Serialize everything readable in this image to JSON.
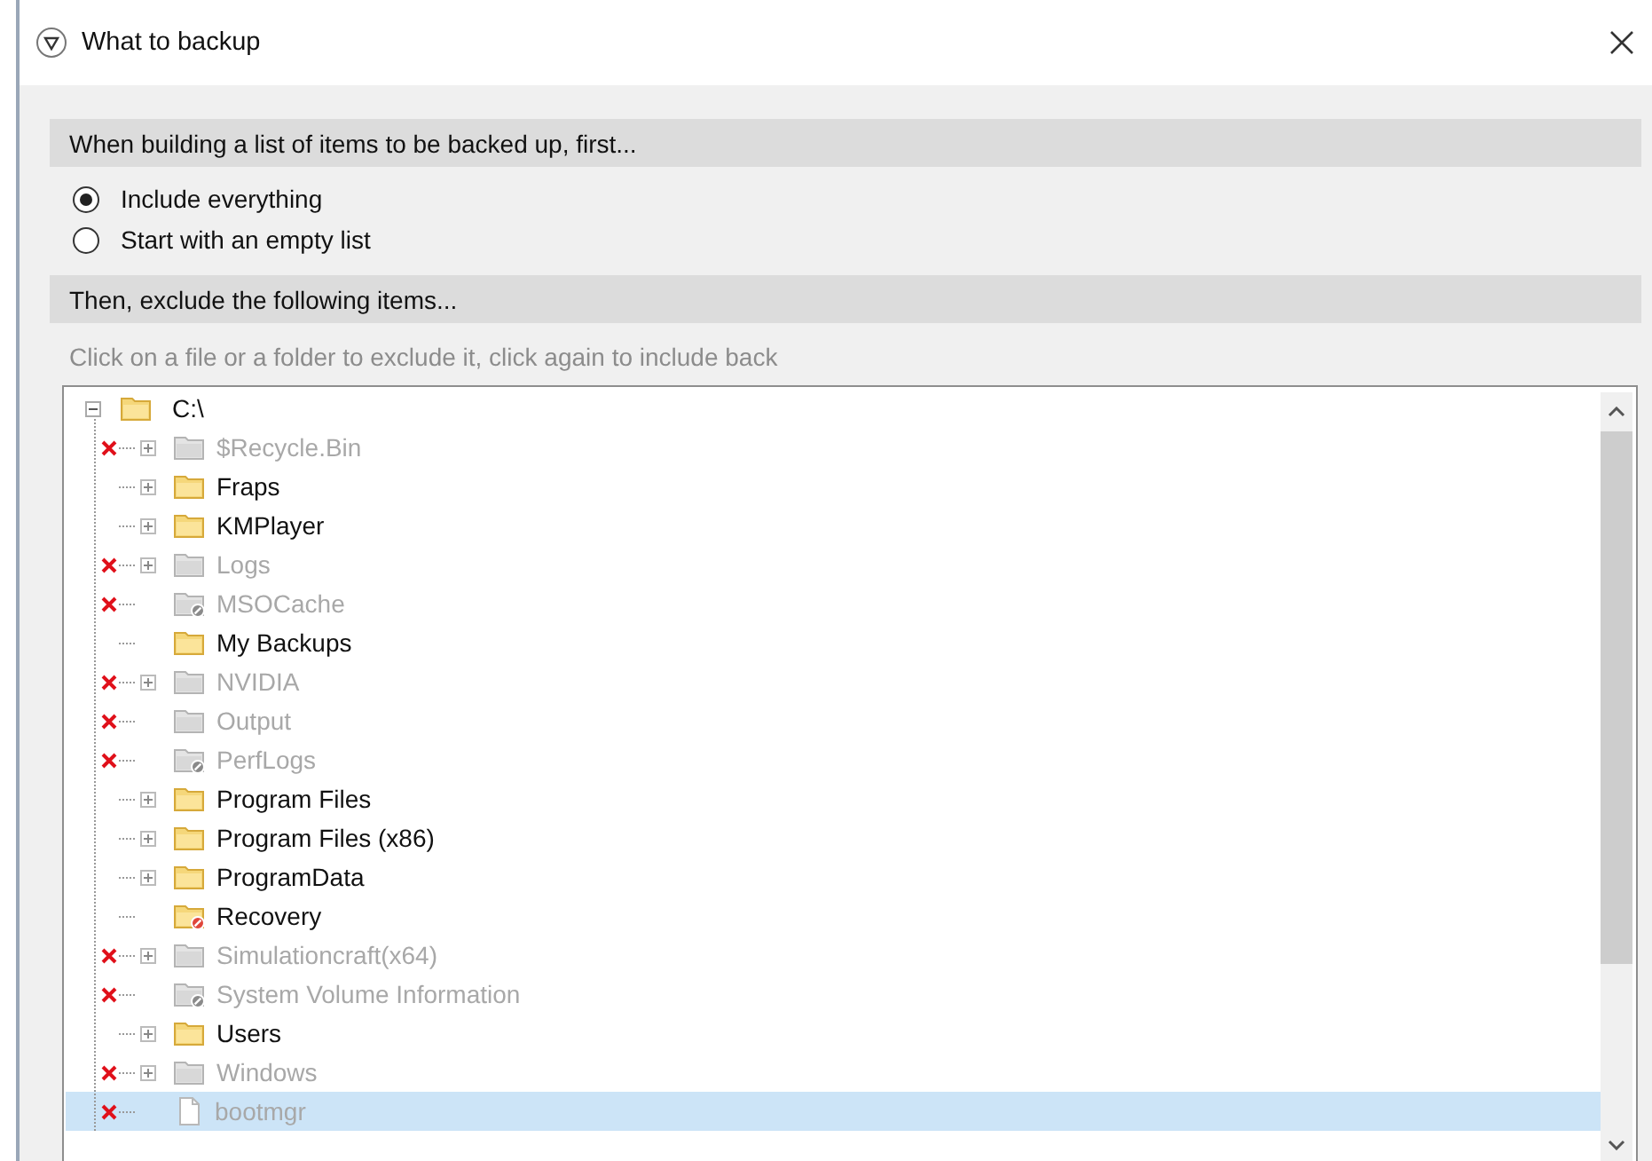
{
  "window": {
    "title": "What to backup"
  },
  "include_section": {
    "heading": "When building a list of items to be backed up, first...",
    "options": [
      {
        "label": "Include everything",
        "selected": true
      },
      {
        "label": "Start with an empty list",
        "selected": false
      }
    ]
  },
  "exclude_section": {
    "heading": "Then, exclude the following items...",
    "hint": "Click on a file or a folder to exclude it, click again to include back"
  },
  "tree": {
    "label": "C:\\",
    "expanded": true,
    "children": [
      {
        "label": "$Recycle.Bin",
        "kind": "folder",
        "excluded": true,
        "expandable": true,
        "selected": false
      },
      {
        "label": "Fraps",
        "kind": "folder",
        "excluded": false,
        "expandable": true,
        "selected": false
      },
      {
        "label": "KMPlayer",
        "kind": "folder",
        "excluded": false,
        "expandable": true,
        "selected": false
      },
      {
        "label": "Logs",
        "kind": "folder",
        "excluded": true,
        "expandable": true,
        "selected": false
      },
      {
        "label": "MSOCache",
        "kind": "restricted-folder",
        "excluded": true,
        "expandable": false,
        "selected": false
      },
      {
        "label": "My Backups",
        "kind": "folder",
        "excluded": false,
        "expandable": false,
        "selected": false
      },
      {
        "label": "NVIDIA",
        "kind": "folder",
        "excluded": true,
        "expandable": true,
        "selected": false
      },
      {
        "label": "Output",
        "kind": "folder",
        "excluded": true,
        "expandable": false,
        "selected": false
      },
      {
        "label": "PerfLogs",
        "kind": "restricted-folder",
        "excluded": true,
        "expandable": false,
        "selected": false
      },
      {
        "label": "Program Files",
        "kind": "folder",
        "excluded": false,
        "expandable": true,
        "selected": false
      },
      {
        "label": "Program Files (x86)",
        "kind": "folder",
        "excluded": false,
        "expandable": true,
        "selected": false
      },
      {
        "label": "ProgramData",
        "kind": "folder",
        "excluded": false,
        "expandable": true,
        "selected": false
      },
      {
        "label": "Recovery",
        "kind": "restricted-folder",
        "excluded": false,
        "expandable": false,
        "selected": false
      },
      {
        "label": "Simulationcraft(x64)",
        "kind": "folder",
        "excluded": true,
        "expandable": true,
        "selected": false
      },
      {
        "label": "System Volume Information",
        "kind": "restricted-folder",
        "excluded": true,
        "expandable": false,
        "selected": false
      },
      {
        "label": "Users",
        "kind": "folder",
        "excluded": false,
        "expandable": true,
        "selected": false
      },
      {
        "label": "Windows",
        "kind": "folder",
        "excluded": true,
        "expandable": true,
        "selected": false
      },
      {
        "label": "bootmgr",
        "kind": "file",
        "excluded": true,
        "expandable": false,
        "selected": true
      }
    ]
  }
}
